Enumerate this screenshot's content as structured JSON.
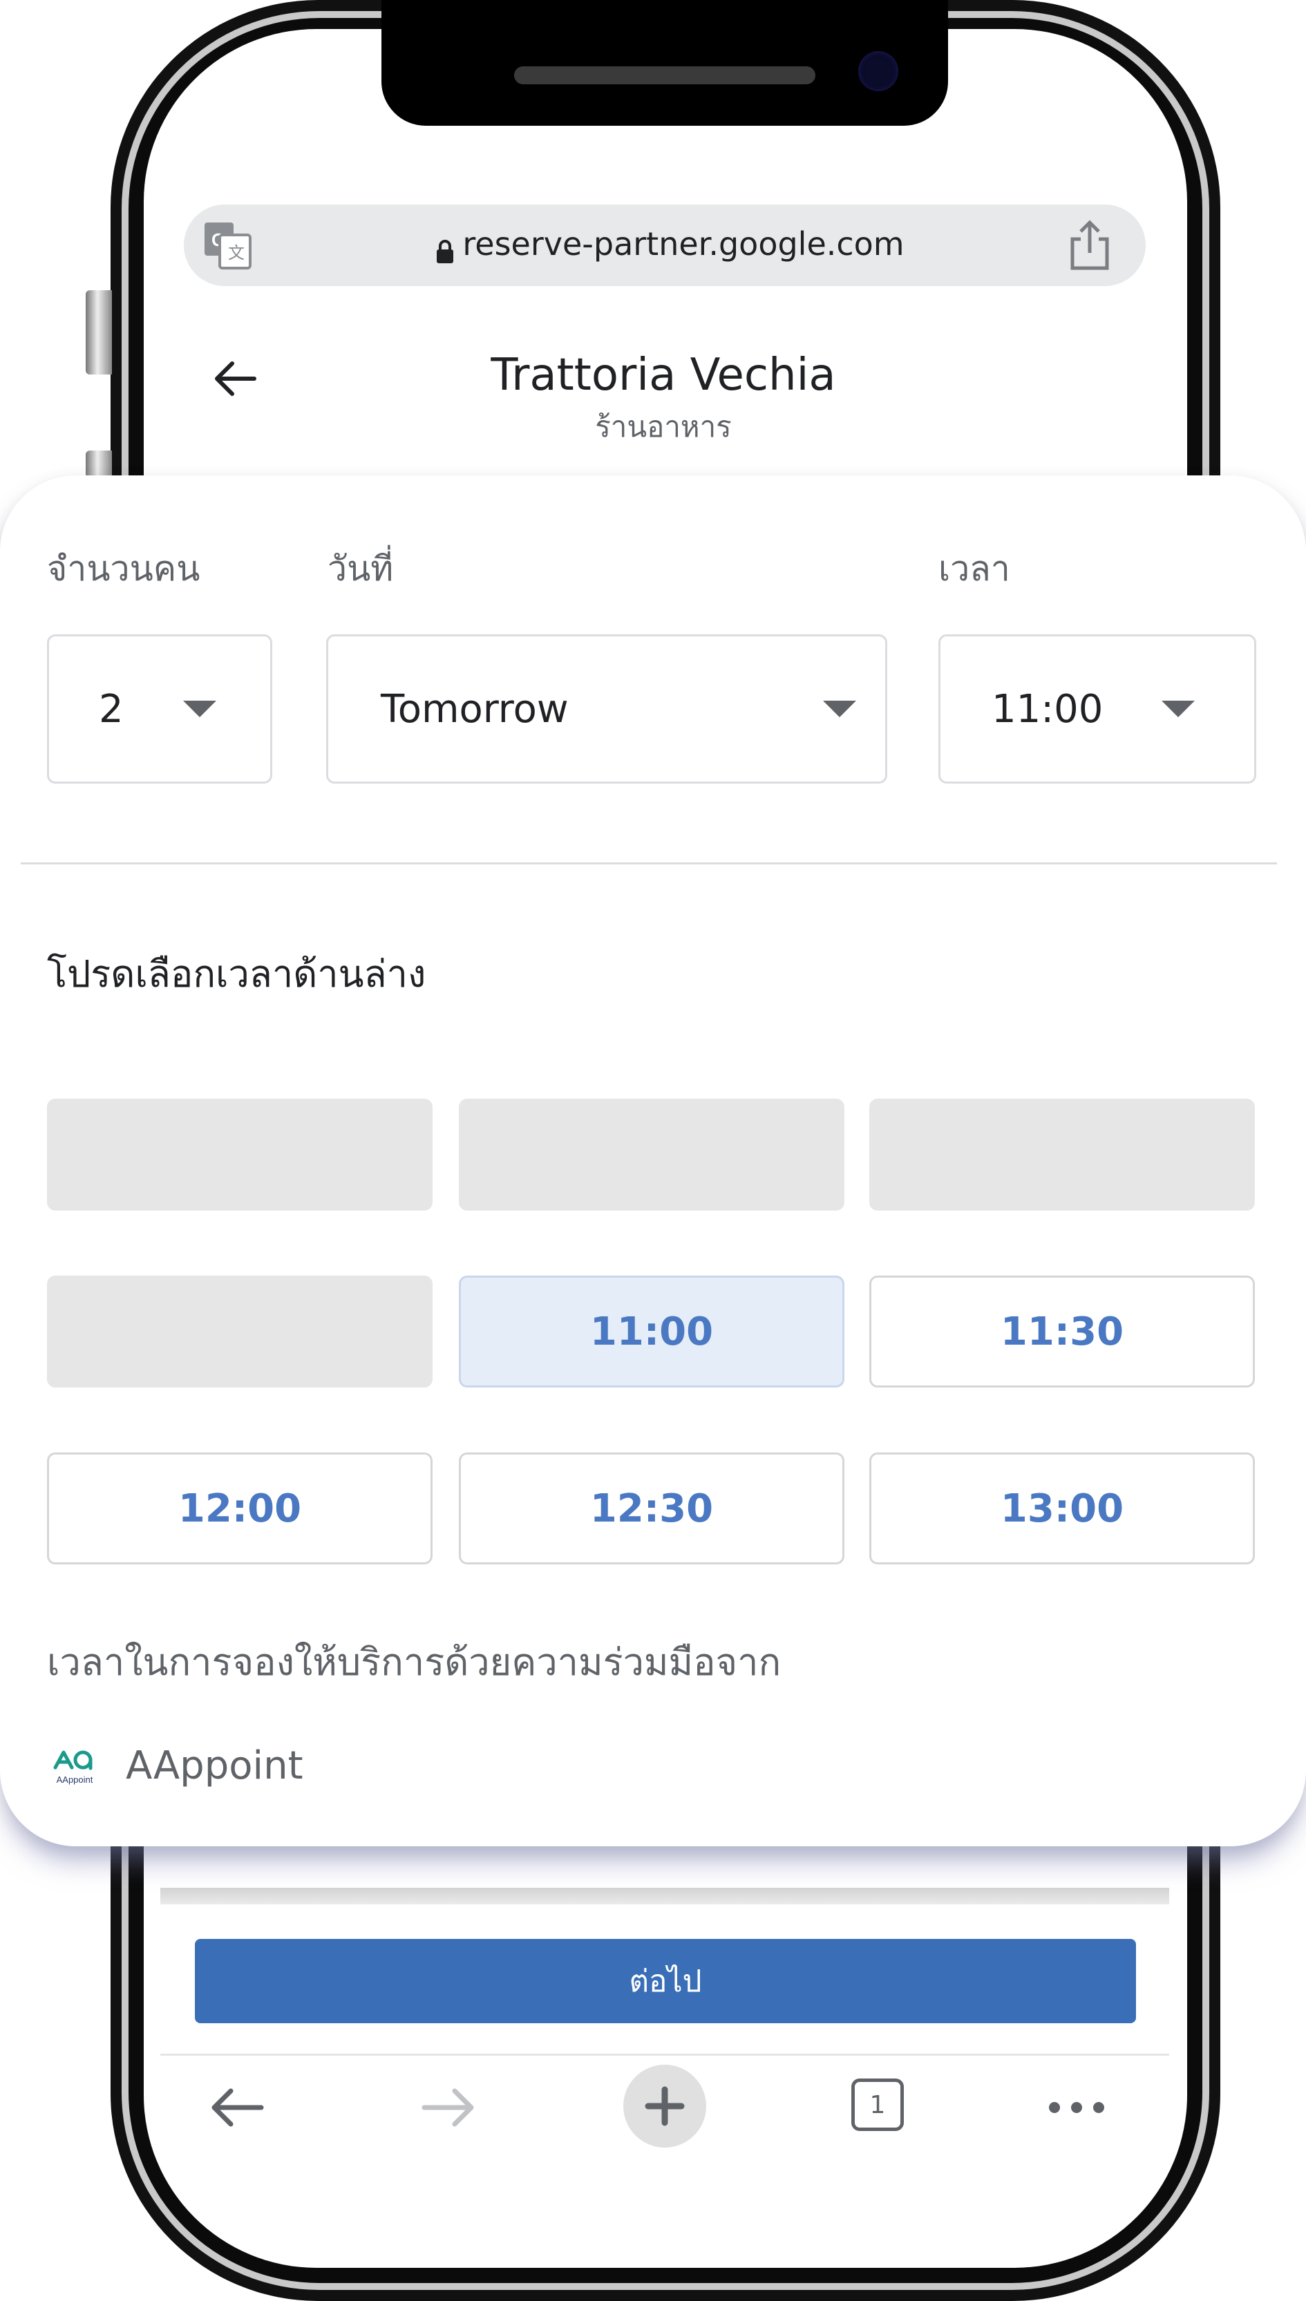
{
  "browser": {
    "url": "reserve-partner.google.com",
    "translate_icon": "google-translate-icon",
    "share_icon": "share-icon",
    "lock_icon": "lock-icon"
  },
  "header": {
    "back_icon": "arrow-left-icon",
    "title": "Trattoria Vechia",
    "subtitle": "ร้านอาหาร"
  },
  "booking": {
    "party_label": "จำนวนคน",
    "party_value": "2",
    "date_label": "วันที่",
    "date_value": "Tomorrow",
    "time_label": "เวลา",
    "time_value": "11:00",
    "prompt": "โปรดเลือกเวลาด้านล่าง",
    "slots": [
      {
        "label": "",
        "state": "unavailable"
      },
      {
        "label": "",
        "state": "unavailable"
      },
      {
        "label": "",
        "state": "unavailable"
      },
      {
        "label": "",
        "state": "unavailable"
      },
      {
        "label": "11:00",
        "state": "selected"
      },
      {
        "label": "11:30",
        "state": "available"
      },
      {
        "label": "12:00",
        "state": "available"
      },
      {
        "label": "12:30",
        "state": "available"
      },
      {
        "label": "13:00",
        "state": "available"
      }
    ],
    "partner_text": "เวลาในการจองให้บริการด้วยความร่วมมือจาก",
    "partner_logo_text": "AAppoint",
    "partner_name": "AAppoint"
  },
  "page": {
    "continue_label": "ต่อไป"
  },
  "toolbar": {
    "icons": [
      "back-icon",
      "forward-icon",
      "new-tab-plus-icon",
      "tab-switcher-icon",
      "more-menu-icon"
    ],
    "tab_count": "1"
  },
  "colors": {
    "accent": "#3a6fb7",
    "slot_text": "#4a78c2",
    "selected_slot_bg": "#e5edf8",
    "unavailable_slot_bg": "#e6e6e6"
  }
}
